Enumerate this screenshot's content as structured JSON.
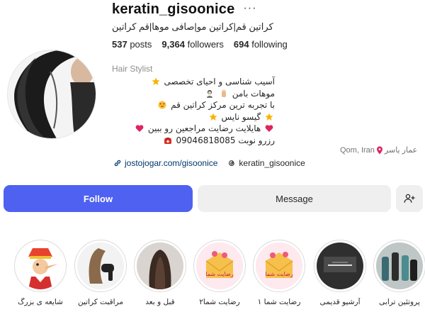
{
  "profile": {
    "username": "keratin_gisoonice",
    "full_name": "کراتین قم|کراتین مو|صافی موها|قم کراتین",
    "category": "Hair Stylist",
    "stats": {
      "posts_count": "537",
      "posts_label": "posts",
      "followers_count": "9,364",
      "followers_label": "followers",
      "following_count": "694",
      "following_label": "following"
    },
    "bio_lines": [
      "آسیب شناسی و احیای تخصصی",
      "موهات بامن",
      "با تجربه ترین مرکز کراتین قم",
      "گیسو نایس",
      "هایلایت رضایت مراجعین رو ببین",
      "رزرو نوبت 09046818085"
    ],
    "location": {
      "city": "Qom, Iran",
      "street": "عمار یاسر"
    },
    "link_url": "jostojogar.com/gisoonice",
    "threads_handle": "keratin_gisoonice",
    "more_glyph": "···"
  },
  "actions": {
    "follow_label": "Follow",
    "message_label": "Message"
  },
  "highlights": [
    {
      "label": "پروتئین ترابی"
    },
    {
      "label": "آرشیو قدیمی"
    },
    {
      "label": "رضایت شما ۱"
    },
    {
      "label": "رضایت شما۲"
    },
    {
      "label": "قبل و بعد"
    },
    {
      "label": "مراقبت کراتین"
    },
    {
      "label": "شایعه ی بزرگ"
    }
  ],
  "highlight_card_text": "رضایت شما",
  "colors": {
    "follow_blue": "#4f61f0",
    "link_blue": "#00376b",
    "secondary_button": "#efefef"
  }
}
